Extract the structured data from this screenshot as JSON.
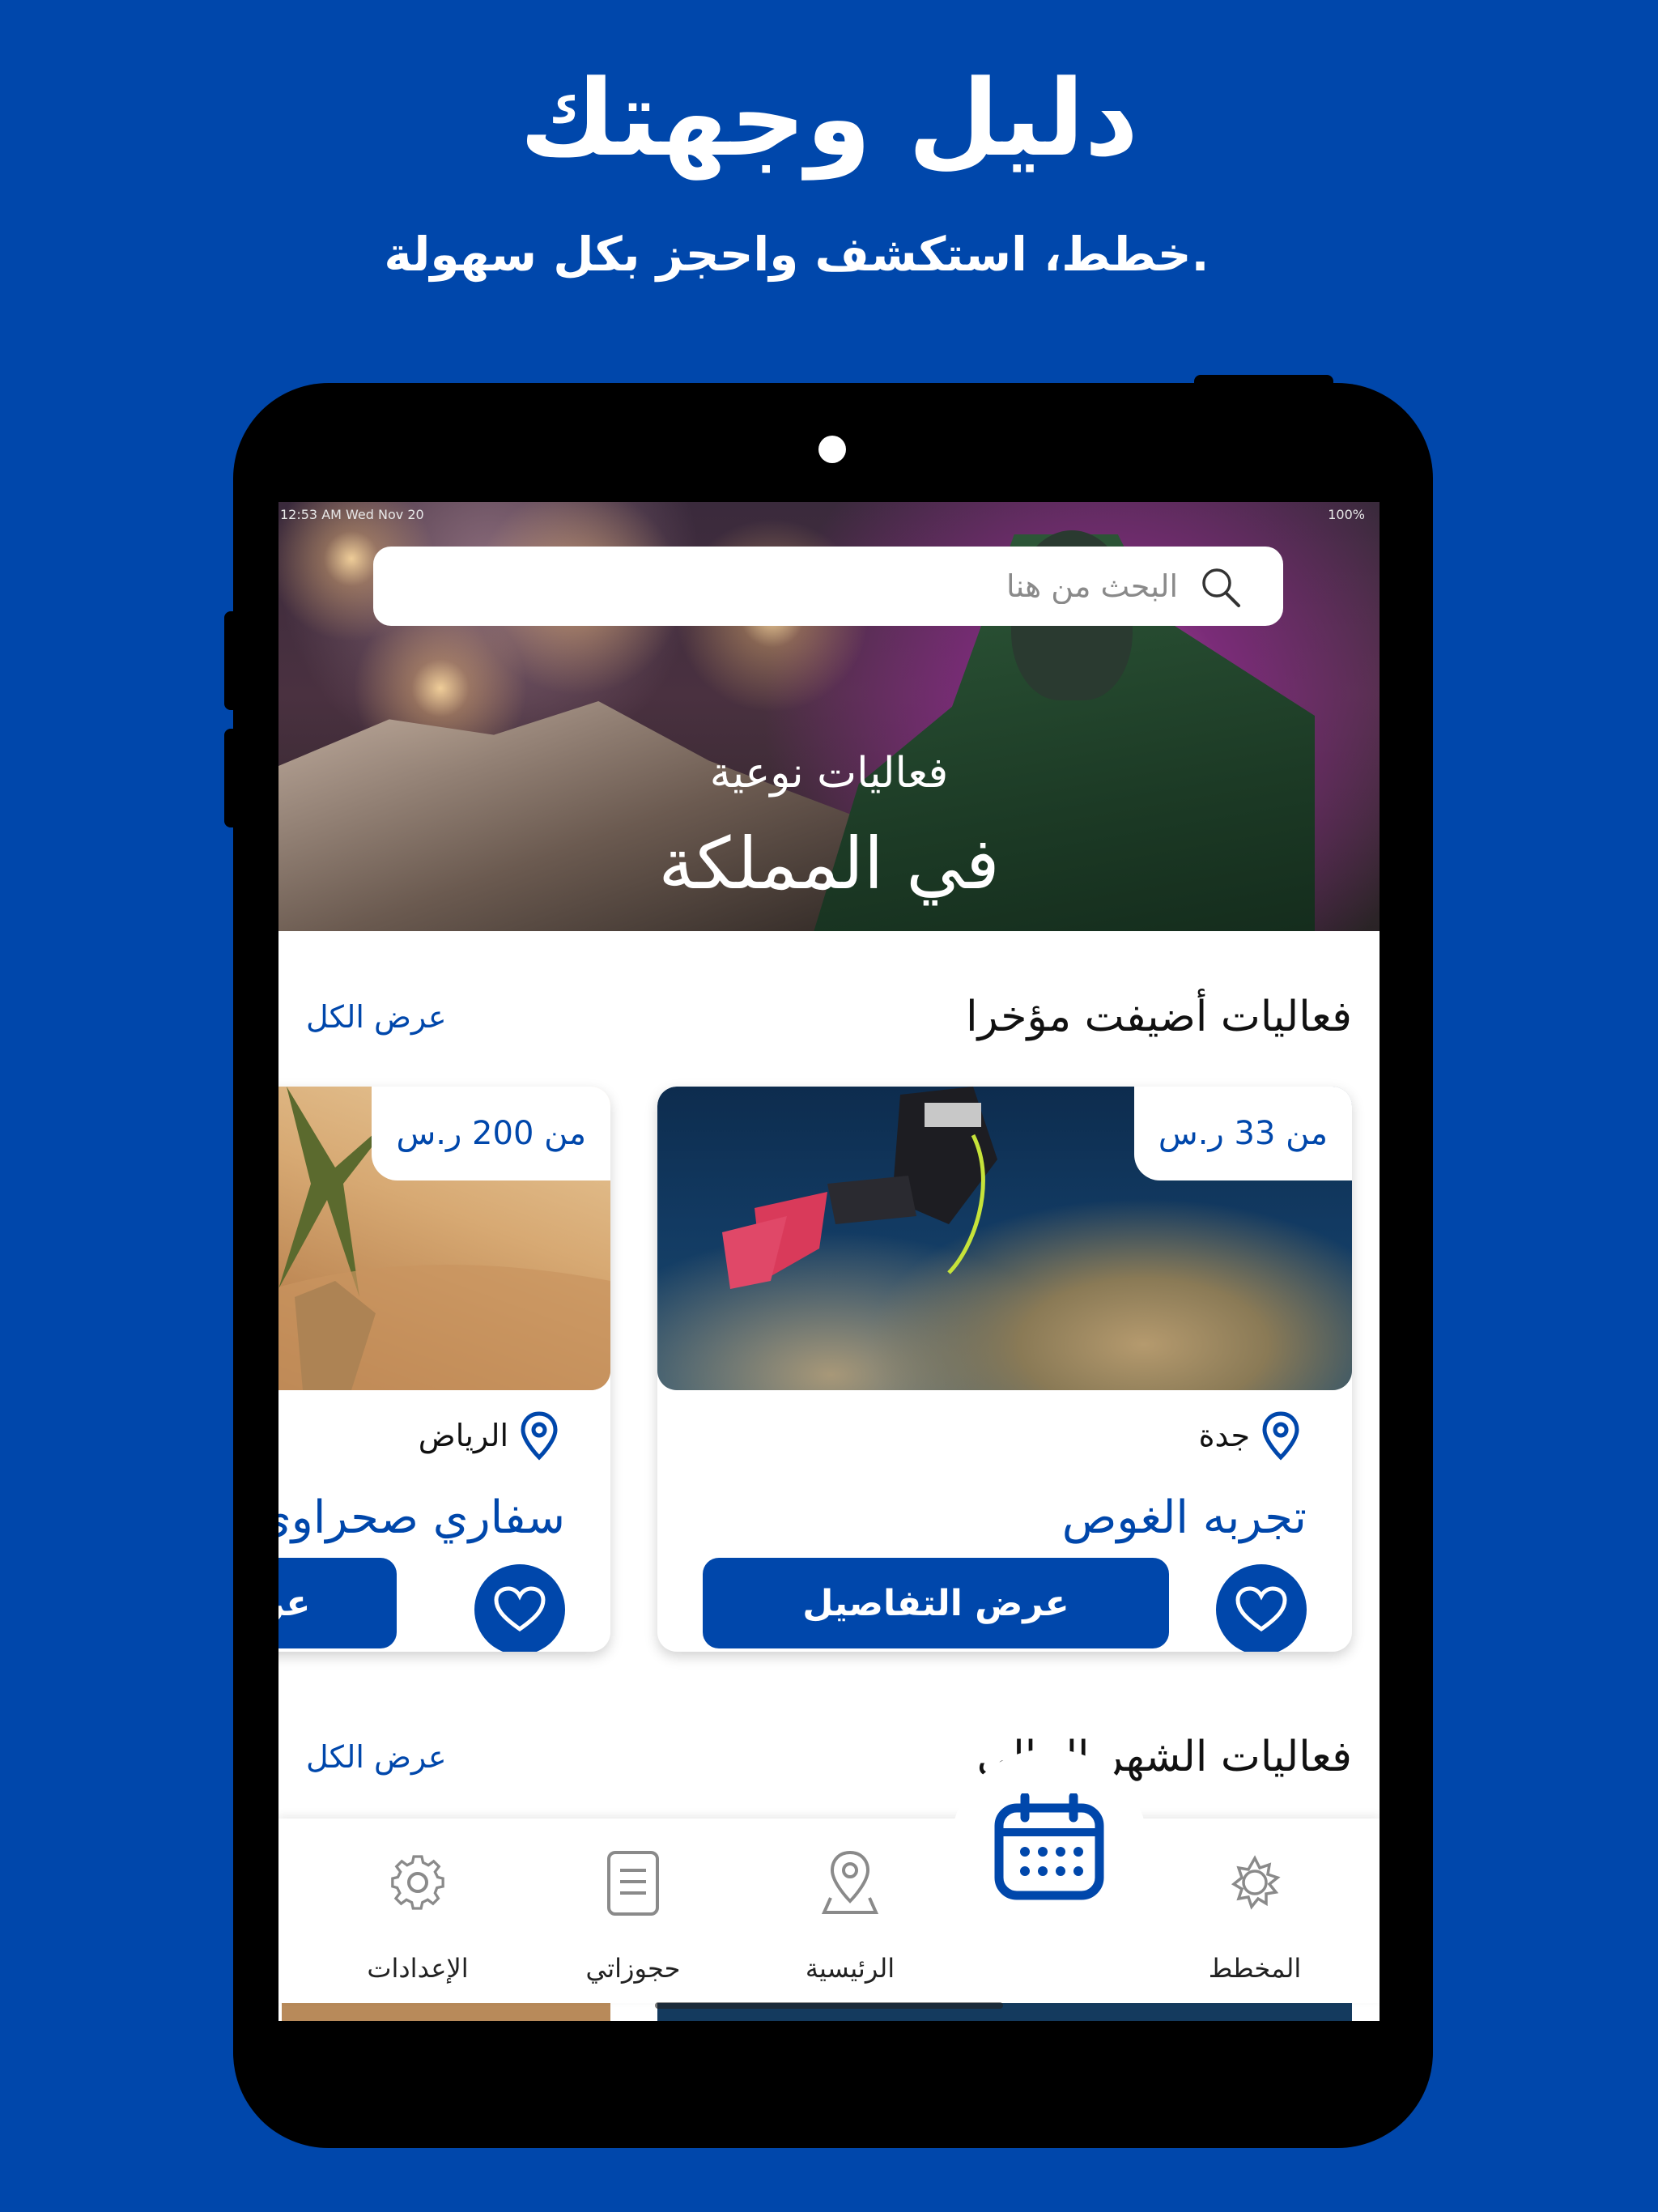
{
  "promo": {
    "headline": "دليل وجهتك",
    "subline": ".خطط، استكشف واحجز بكل سهولة"
  },
  "status_bar": {
    "time": "12:53 AM  Wed Nov 20",
    "battery": "100%"
  },
  "search": {
    "placeholder": "البحث من هنا",
    "icon": "search-icon"
  },
  "hero": {
    "subtitle": "فعاليات نوعية",
    "title": "في المملكة"
  },
  "sections": [
    {
      "title": "فعاليات أضيفت مؤخرا",
      "link": "عرض الكل"
    },
    {
      "title": "فعاليات الشهر الحالي",
      "link": "عرض الكل"
    }
  ],
  "cards": [
    {
      "price": "من 33 ر.س",
      "location": "جدة",
      "title": "تجربه الغوص",
      "button": "عرض التفاصيل"
    },
    {
      "price": "من 200 ر.س",
      "location": "الرياض",
      "title": "سفاري صحراوي",
      "button": "عرض التفاصيل"
    }
  ],
  "nav": {
    "items": [
      {
        "label": "الإعدادات",
        "icon": "settings-icon"
      },
      {
        "label": "حجوزاتي",
        "icon": "document-icon"
      },
      {
        "label": "الرئيسية",
        "icon": "map-pin-icon"
      },
      {
        "label": "المخطط",
        "icon": "sun-icon"
      }
    ],
    "fab_icon": "calendar-icon"
  },
  "colors": {
    "brand": "#0047AB",
    "white": "#FFFFFF",
    "text": "#111111"
  }
}
